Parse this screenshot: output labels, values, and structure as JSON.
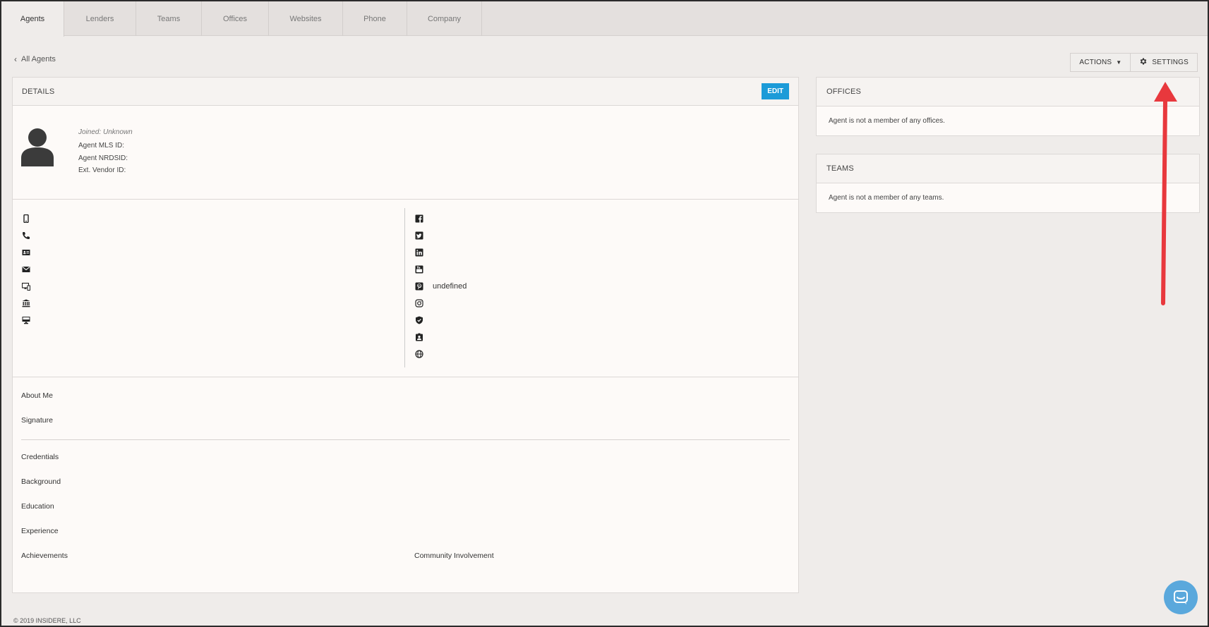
{
  "tabs": [
    {
      "label": "Agents",
      "active": true
    },
    {
      "label": "Lenders",
      "active": false
    },
    {
      "label": "Teams",
      "active": false
    },
    {
      "label": "Offices",
      "active": false
    },
    {
      "label": "Websites",
      "active": false
    },
    {
      "label": "Phone",
      "active": false
    },
    {
      "label": "Company",
      "active": false
    }
  ],
  "breadcrumb": {
    "back_label": "All Agents"
  },
  "top_actions": {
    "actions_label": "ACTIONS",
    "settings_label": "SETTINGS"
  },
  "details": {
    "title": "DETAILS",
    "edit_label": "EDIT",
    "joined": "Joined: Unknown",
    "mls_label": "Agent MLS ID:",
    "nrds_label": "Agent NRDSID:",
    "vendor_label": "Ext. Vendor ID:"
  },
  "contacts": {
    "left": [
      {
        "icon": "mobile-icon",
        "value": ""
      },
      {
        "icon": "phone-icon",
        "value": ""
      },
      {
        "icon": "contact-card-icon",
        "value": ""
      },
      {
        "icon": "email-icon",
        "value": ""
      },
      {
        "icon": "devices-icon",
        "value": ""
      },
      {
        "icon": "bank-icon",
        "value": ""
      },
      {
        "icon": "monitor-icon",
        "value": ""
      }
    ],
    "right": [
      {
        "icon": "facebook-icon",
        "value": ""
      },
      {
        "icon": "twitter-icon",
        "value": ""
      },
      {
        "icon": "linkedin-icon",
        "value": ""
      },
      {
        "icon": "youtube-icon",
        "value": ""
      },
      {
        "icon": "pinterest-icon",
        "value": "undefined"
      },
      {
        "icon": "instagram-icon",
        "value": ""
      },
      {
        "icon": "shield-icon",
        "value": ""
      },
      {
        "icon": "badge-icon",
        "value": ""
      },
      {
        "icon": "globe-icon",
        "value": ""
      }
    ]
  },
  "sections": {
    "about_me": "About Me",
    "signature": "Signature",
    "credentials": "Credentials",
    "background": "Background",
    "education": "Education",
    "experience": "Experience",
    "achievements": "Achievements",
    "community": "Community Involvement"
  },
  "offices": {
    "title": "OFFICES",
    "empty": "Agent is not a member of any offices."
  },
  "teams": {
    "title": "TEAMS",
    "empty": "Agent is not a member of any teams."
  },
  "footer": {
    "copyright": "© 2019 INSIDERE, LLC"
  },
  "colors": {
    "accent": "#1c9bd8",
    "arrow": "#e8383d",
    "chat": "#5aa8dc"
  }
}
